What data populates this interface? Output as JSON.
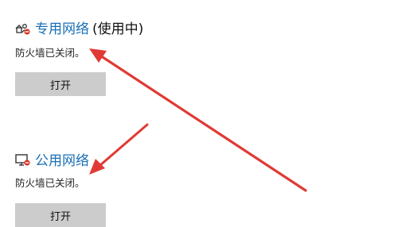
{
  "private_network": {
    "title": "专用网络",
    "state": "(使用中)",
    "status": "防火墙已关闭。",
    "button_label": "打开",
    "icon": "private-network-icon"
  },
  "public_network": {
    "title": "公用网络",
    "status": "防火墙已关闭。",
    "button_label": "打开",
    "icon": "public-network-icon"
  },
  "colors": {
    "link": "#1a6fb6",
    "button_bg": "#cccccc",
    "annotation_arrow": "#e03a34",
    "warning_badge": "#d9342b"
  }
}
